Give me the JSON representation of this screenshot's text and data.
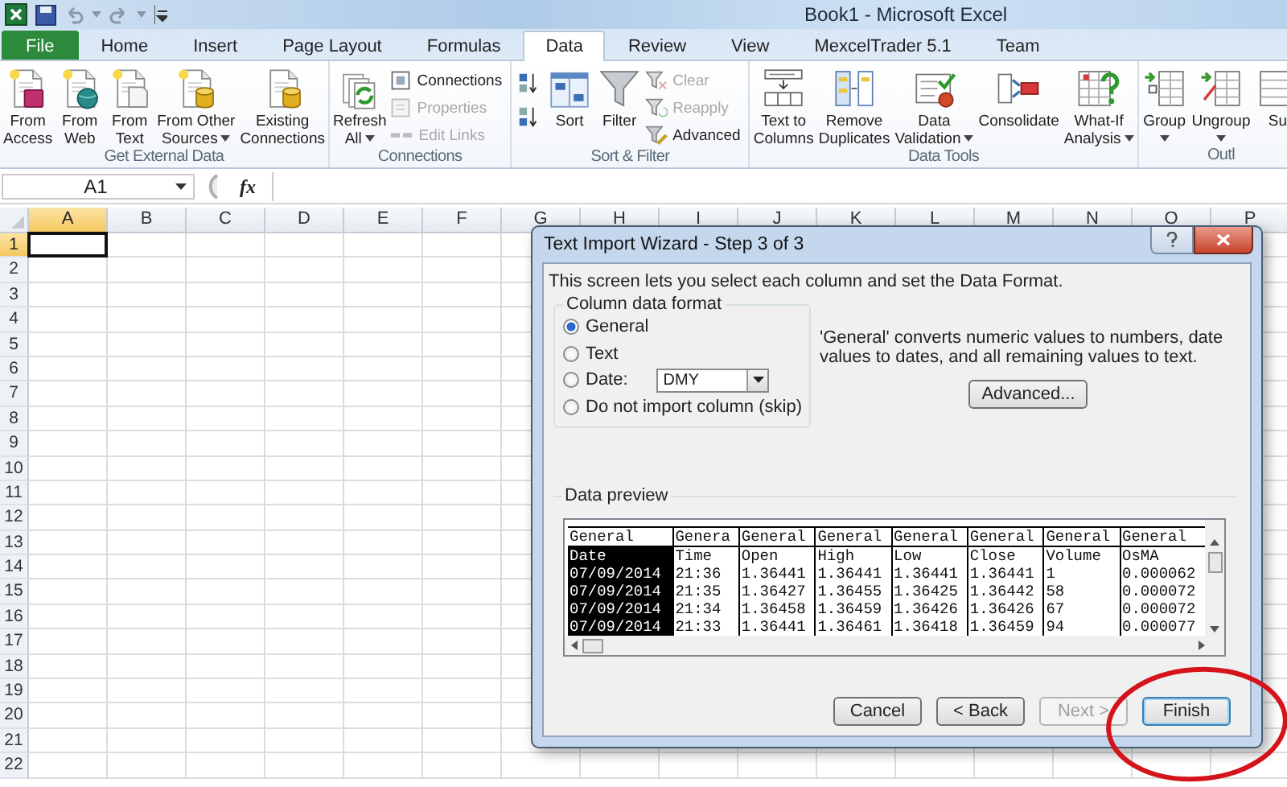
{
  "window": {
    "title": "Book1 - Microsoft Excel"
  },
  "tabs": [
    {
      "label": "File",
      "kind": "menu",
      "selected": false
    },
    {
      "label": "Home",
      "kind": "tab",
      "selected": false
    },
    {
      "label": "Insert",
      "kind": "tab",
      "selected": false
    },
    {
      "label": "Page Layout",
      "kind": "tab",
      "selected": false
    },
    {
      "label": "Formulas",
      "kind": "tab",
      "selected": false
    },
    {
      "label": "Data",
      "kind": "tab",
      "selected": true
    },
    {
      "label": "Review",
      "kind": "tab",
      "selected": false
    },
    {
      "label": "View",
      "kind": "tab",
      "selected": false
    },
    {
      "label": "MexcelTrader 5.1",
      "kind": "tab",
      "selected": false
    },
    {
      "label": "Team",
      "kind": "tab",
      "selected": false
    }
  ],
  "ribbon": [
    {
      "label": "Get External Data",
      "items": [
        {
          "kind": "large",
          "lines": [
            "From",
            "Access"
          ],
          "dropdown": false
        },
        {
          "kind": "large",
          "lines": [
            "From",
            "Web"
          ],
          "dropdown": false
        },
        {
          "kind": "large",
          "lines": [
            "From",
            "Text"
          ],
          "dropdown": false
        },
        {
          "kind": "large",
          "lines": [
            "From Other",
            "Sources"
          ],
          "dropdown": true
        },
        {
          "kind": "large",
          "lines": [
            "Existing",
            "Connections"
          ],
          "dropdown": false
        }
      ]
    },
    {
      "label": "Connections",
      "items": [
        {
          "kind": "large",
          "lines": [
            "Refresh",
            "All"
          ],
          "dropdown": true
        },
        {
          "kind": "stack",
          "buttons": [
            {
              "label": "Connections",
              "disabled": false
            },
            {
              "label": "Properties",
              "disabled": true
            },
            {
              "label": "Edit Links",
              "disabled": true
            }
          ]
        }
      ]
    },
    {
      "label": "Sort & Filter",
      "items": [
        {
          "kind": "icon_stack"
        },
        {
          "kind": "large",
          "lines": [
            "Sort"
          ],
          "dropdown": false
        },
        {
          "kind": "large",
          "lines": [
            "Filter"
          ],
          "dropdown": false
        },
        {
          "kind": "stack",
          "buttons": [
            {
              "label": "Clear",
              "disabled": true
            },
            {
              "label": "Reapply",
              "disabled": true
            },
            {
              "label": "Advanced",
              "disabled": false
            }
          ]
        }
      ]
    },
    {
      "label": "Data Tools",
      "items": [
        {
          "kind": "large",
          "lines": [
            "Text to",
            "Columns"
          ],
          "dropdown": false
        },
        {
          "kind": "large",
          "lines": [
            "Remove",
            "Duplicates"
          ],
          "dropdown": false
        },
        {
          "kind": "large",
          "lines": [
            "Data",
            "Validation"
          ],
          "dropdown": true
        },
        {
          "kind": "large",
          "lines": [
            "Consolidate"
          ],
          "dropdown": false
        },
        {
          "kind": "large",
          "lines": [
            "What-If",
            "Analysis"
          ],
          "dropdown": true
        }
      ]
    },
    {
      "label": "Outl",
      "items": [
        {
          "kind": "large",
          "lines": [
            "Group"
          ],
          "dropdown": true
        },
        {
          "kind": "large",
          "lines": [
            "Ungroup"
          ],
          "dropdown": true
        },
        {
          "kind": "large",
          "lines": [
            "Su"
          ],
          "dropdown": false
        }
      ]
    }
  ],
  "formula_bar": {
    "name_box": "A1",
    "function_label": "fx"
  },
  "sheet": {
    "columns": [
      {
        "label": "A",
        "selected": true
      },
      {
        "label": "B",
        "selected": false
      },
      {
        "label": "C",
        "selected": false
      },
      {
        "label": "D",
        "selected": false
      },
      {
        "label": "E",
        "selected": false
      },
      {
        "label": "F",
        "selected": false
      },
      {
        "label": "G",
        "selected": false
      },
      {
        "label": "H",
        "selected": false
      },
      {
        "label": "I",
        "selected": false
      },
      {
        "label": "J",
        "selected": false
      },
      {
        "label": "K",
        "selected": false
      },
      {
        "label": "L",
        "selected": false
      },
      {
        "label": "M",
        "selected": false
      },
      {
        "label": "N",
        "selected": false
      },
      {
        "label": "O",
        "selected": false
      },
      {
        "label": "P",
        "selected": false
      }
    ],
    "rows": [
      {
        "label": "1",
        "selected": true
      },
      {
        "label": "2",
        "selected": false
      },
      {
        "label": "3",
        "selected": false
      },
      {
        "label": "4",
        "selected": false
      },
      {
        "label": "5",
        "selected": false
      },
      {
        "label": "6",
        "selected": false
      },
      {
        "label": "7",
        "selected": false
      },
      {
        "label": "8",
        "selected": false
      },
      {
        "label": "9",
        "selected": false
      },
      {
        "label": "10",
        "selected": false
      },
      {
        "label": "11",
        "selected": false
      },
      {
        "label": "12",
        "selected": false
      },
      {
        "label": "13",
        "selected": false
      },
      {
        "label": "14",
        "selected": false
      },
      {
        "label": "15",
        "selected": false
      },
      {
        "label": "16",
        "selected": false
      },
      {
        "label": "17",
        "selected": false
      },
      {
        "label": "18",
        "selected": false
      },
      {
        "label": "19",
        "selected": false
      },
      {
        "label": "20",
        "selected": false
      },
      {
        "label": "21",
        "selected": false
      },
      {
        "label": "22",
        "selected": false
      }
    ]
  },
  "dialog": {
    "title": "Text Import Wizard - Step 3 of 3",
    "intro": "This screen lets you select each column and set the Data Format.",
    "format_group": {
      "label": "Column data format",
      "options": [
        {
          "label": "General",
          "selected": true
        },
        {
          "label": "Text",
          "selected": false
        },
        {
          "label": "Date:",
          "selected": false,
          "dropdown": "DMY"
        },
        {
          "label": "Do not import column (skip)",
          "selected": false
        }
      ]
    },
    "description": "'General' converts numeric values to numbers, date values to dates, and all remaining values to text.",
    "advanced_button": "Advanced...",
    "preview": {
      "label": "Data preview",
      "columns": [
        {
          "format": "General",
          "selected": true
        },
        {
          "format": "Genera",
          "selected": false
        },
        {
          "format": "General",
          "selected": false
        },
        {
          "format": "General",
          "selected": false
        },
        {
          "format": "General",
          "selected": false
        },
        {
          "format": "General",
          "selected": false
        },
        {
          "format": "General",
          "selected": false
        },
        {
          "format": "General",
          "selected": false
        }
      ],
      "rows": [
        [
          "Date",
          "Time",
          "Open",
          "High",
          "Low",
          "Close",
          "Volume",
          "OsMA"
        ],
        [
          "07/09/2014",
          "21:36",
          "1.36441",
          "1.36441",
          "1.36441",
          "1.36441",
          "1",
          "0.000062"
        ],
        [
          "07/09/2014",
          "21:35",
          "1.36427",
          "1.36455",
          "1.36425",
          "1.36442",
          "58",
          "0.000072"
        ],
        [
          "07/09/2014",
          "21:34",
          "1.36458",
          "1.36459",
          "1.36426",
          "1.36426",
          "67",
          "0.000072"
        ],
        [
          "07/09/2014",
          "21:33",
          "1.36441",
          "1.36461",
          "1.36418",
          "1.36459",
          "94",
          "0.000077"
        ]
      ]
    },
    "buttons": [
      {
        "label": "Cancel",
        "disabled": false,
        "default": false
      },
      {
        "label": "< Back",
        "disabled": false,
        "default": false
      },
      {
        "label": "Next >",
        "disabled": true,
        "default": false
      },
      {
        "label": "Finish",
        "disabled": false,
        "default": true
      }
    ]
  }
}
